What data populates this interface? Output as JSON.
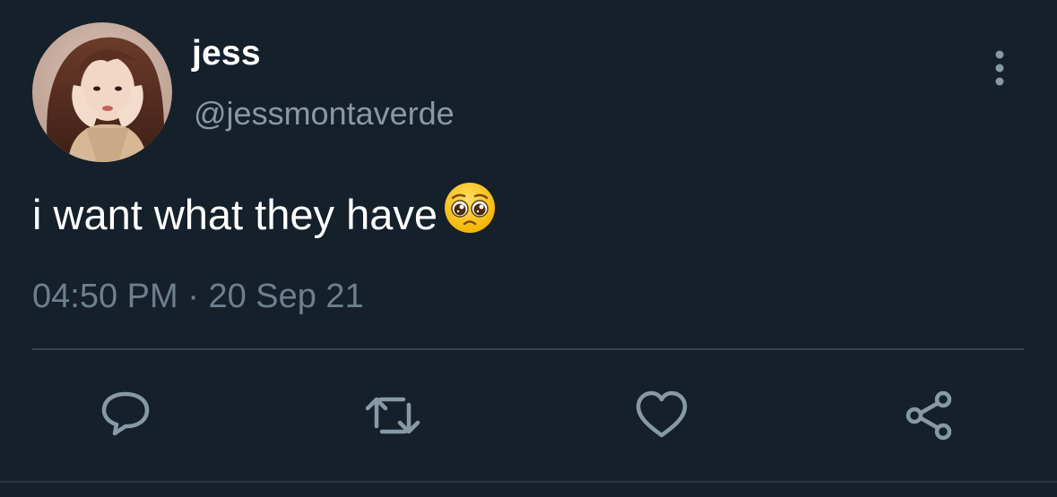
{
  "tweet": {
    "author": {
      "display_name": "jess",
      "handle": "@jessmontaverde"
    },
    "text": "i want what they have",
    "emoji": "pleading-face",
    "time": "04:50 PM",
    "separator": "·",
    "date": "20 Sep 21"
  },
  "actions": {
    "reply": "reply-icon",
    "retweet": "retweet-icon",
    "like": "heart-icon",
    "share": "share-icon"
  },
  "colors": {
    "background": "#15202b",
    "text_primary": "#ffffff",
    "text_secondary": "#8899a6",
    "icon": "#8899a6",
    "divider": "#38444d"
  }
}
